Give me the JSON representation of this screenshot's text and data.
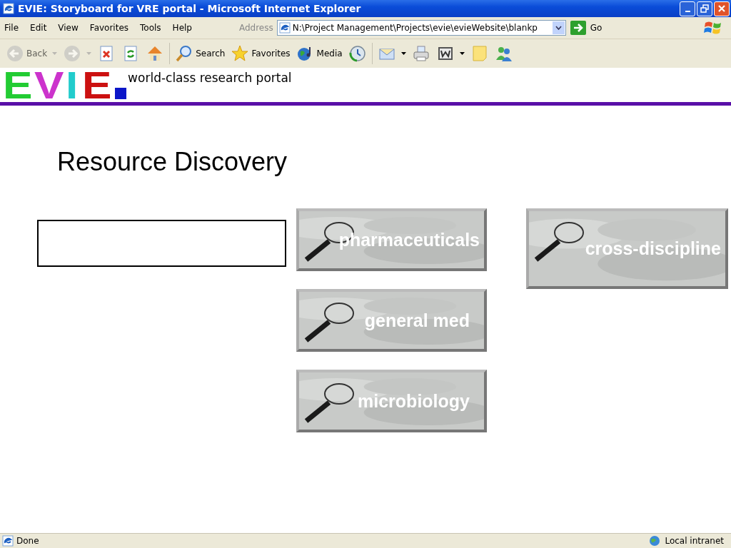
{
  "window": {
    "title": "EVIE: Storyboard for VRE portal - Microsoft Internet Explorer"
  },
  "menu": [
    "File",
    "Edit",
    "View",
    "Favorites",
    "Tools",
    "Help"
  ],
  "address": {
    "label": "Address",
    "value": "N:\\Project Management\\Projects\\evie\\evieWebsite\\blankp",
    "go": "Go"
  },
  "toolbar": [
    {
      "kind": "back",
      "label": "Back",
      "disabled": true,
      "dropdown": true
    },
    {
      "kind": "forward",
      "disabled": true,
      "dropdown": true
    },
    {
      "kind": "stop",
      "disabled": false,
      "dropdown": false
    },
    {
      "kind": "refresh",
      "disabled": false,
      "dropdown": false
    },
    {
      "kind": "home",
      "disabled": false,
      "dropdown": false
    },
    {
      "kind": "search",
      "label": "Search",
      "disabled": false,
      "dropdown": false
    },
    {
      "kind": "favorites",
      "label": "Favorites",
      "disabled": false,
      "dropdown": false
    },
    {
      "kind": "media",
      "label": "Media",
      "disabled": false,
      "dropdown": false
    },
    {
      "kind": "history",
      "disabled": false,
      "dropdown": false
    },
    {
      "kind": "mail",
      "disabled": false,
      "dropdown": true
    },
    {
      "kind": "print",
      "disabled": false,
      "dropdown": false
    },
    {
      "kind": "word",
      "disabled": false,
      "dropdown": true
    },
    {
      "kind": "note",
      "disabled": false,
      "dropdown": false
    },
    {
      "kind": "messenger",
      "disabled": false,
      "dropdown": false
    }
  ],
  "page": {
    "logo": [
      {
        "char": "E",
        "color": "#22cc33"
      },
      {
        "char": "V",
        "color": "#cc33cc"
      },
      {
        "char": "I",
        "color": "#22cccc"
      },
      {
        "char": "E",
        "color": "#cc1111"
      }
    ],
    "tagline": "world-class research portal",
    "heading": "Resource Discovery",
    "button_columns": [
      [
        {
          "label": "pharmaceuticals"
        },
        {
          "label": "general med"
        },
        {
          "label": "microbiology"
        }
      ],
      [
        {
          "label": "cross-discipline"
        }
      ]
    ]
  },
  "status_bar": {
    "text": "Done",
    "zone": "Local intranet"
  }
}
